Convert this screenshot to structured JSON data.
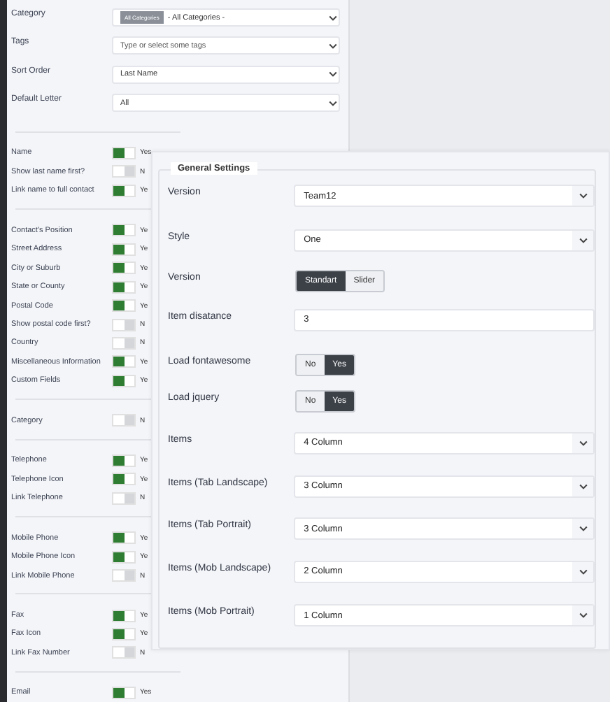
{
  "filters": [
    {
      "label": "Category",
      "kind": "select",
      "chip": "All Categories",
      "value": "- All Categories -"
    },
    {
      "label": "Tags",
      "kind": "select",
      "placeholder": "Type or select some tags"
    },
    {
      "label": "Sort Order",
      "kind": "select",
      "value": "Last Name"
    },
    {
      "label": "Default Letter",
      "kind": "select",
      "value": "All"
    }
  ],
  "toggle_groups": [
    [
      {
        "label": "Name",
        "on": true,
        "state": "Yes"
      },
      {
        "label": "Show last name first?",
        "on": false,
        "state": "N"
      },
      {
        "label": "Link name to full contact",
        "on": true,
        "state": "Ye"
      }
    ],
    [
      {
        "label": "Contact's Position",
        "on": true,
        "state": "Ye"
      },
      {
        "label": "Street Address",
        "on": true,
        "state": "Ye"
      },
      {
        "label": "City or Suburb",
        "on": true,
        "state": "Ye"
      },
      {
        "label": "State or County",
        "on": true,
        "state": "Ye"
      },
      {
        "label": "Postal Code",
        "on": true,
        "state": "Ye"
      },
      {
        "label": "Show postal code first?",
        "on": false,
        "state": "N"
      },
      {
        "label": "Country",
        "on": false,
        "state": "N"
      },
      {
        "label": "Miscellaneous Information",
        "on": true,
        "state": "Ye"
      },
      {
        "label": "Custom Fields",
        "on": true,
        "state": "Ye"
      }
    ],
    [
      {
        "label": "Category",
        "on": false,
        "state": "N"
      }
    ],
    [
      {
        "label": "Telephone",
        "on": true,
        "state": "Ye"
      },
      {
        "label": "Telephone Icon",
        "on": true,
        "state": "Ye"
      },
      {
        "label": "Link Telephone",
        "on": false,
        "state": "N"
      }
    ],
    [
      {
        "label": "Mobile Phone",
        "on": true,
        "state": "Ye"
      },
      {
        "label": "Mobile Phone Icon",
        "on": true,
        "state": "Ye"
      },
      {
        "label": "Link Mobile Phone",
        "on": false,
        "state": "N"
      }
    ],
    [
      {
        "label": "Fax",
        "on": true,
        "state": "Ye"
      },
      {
        "label": "Fax Icon",
        "on": true,
        "state": "Ye"
      },
      {
        "label": "Link Fax Number",
        "on": false,
        "state": "N"
      }
    ],
    [
      {
        "label": "Email",
        "on": true,
        "state": "Yes"
      }
    ]
  ],
  "general_settings": {
    "legend": "General Settings",
    "fields": [
      {
        "label": "Version",
        "kind": "select",
        "value": "Team12"
      },
      {
        "label": "Style",
        "kind": "select",
        "value": "One"
      },
      {
        "label": "Version",
        "kind": "segmented",
        "options": [
          {
            "label": "Standart",
            "selected": true
          },
          {
            "label": "Slider",
            "selected": false
          }
        ]
      },
      {
        "label": "Item disatance",
        "kind": "text",
        "value": "3"
      },
      {
        "label": "Load fontawesome",
        "kind": "segmented",
        "options": [
          {
            "label": "No",
            "selected": false
          },
          {
            "label": "Yes",
            "selected": true
          }
        ]
      },
      {
        "label": "Load jquery",
        "kind": "segmented",
        "options": [
          {
            "label": "No",
            "selected": false
          },
          {
            "label": "Yes",
            "selected": true
          }
        ]
      },
      {
        "label": "Items",
        "kind": "select",
        "value": "4 Column"
      },
      {
        "label": "Items (Tab Landscape)",
        "kind": "select",
        "value": "3 Column"
      },
      {
        "label": "Items (Tab Portrait)",
        "kind": "select",
        "value": "3 Column"
      },
      {
        "label": "Items (Mob Landscape)",
        "kind": "select",
        "value": "2 Column"
      },
      {
        "label": "Items (Mob Portrait)",
        "kind": "select",
        "value": "1 Column"
      }
    ]
  }
}
